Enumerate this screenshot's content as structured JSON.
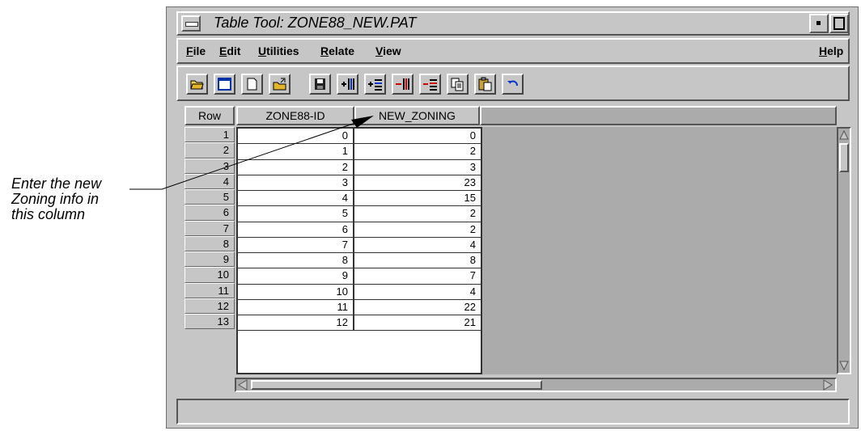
{
  "annotation": {
    "lines": [
      "Enter the new",
      "Zoning info in",
      "this column"
    ]
  },
  "window": {
    "title": "Table Tool: ZONE88_NEW.PAT"
  },
  "menu": {
    "file": "File",
    "edit": "Edit",
    "utilities": "Utilities",
    "relate": "Relate",
    "view": "View",
    "help": "Help"
  },
  "toolbar": {
    "icons": [
      "open-folder-icon",
      "new-window-icon",
      "new-document-icon",
      "open-file-icon",
      "save-icon",
      "add-column-icon",
      "add-row-icon",
      "delete-column-icon",
      "delete-row-icon",
      "copy-icon",
      "paste-icon",
      "undo-icon"
    ]
  },
  "table": {
    "headers": [
      "Row",
      "ZONE88-ID",
      "NEW_ZONING"
    ],
    "rows": [
      {
        "row": "1",
        "zone88_id": "0",
        "new_zoning": "0"
      },
      {
        "row": "2",
        "zone88_id": "1",
        "new_zoning": "2"
      },
      {
        "row": "3",
        "zone88_id": "2",
        "new_zoning": "3"
      },
      {
        "row": "4",
        "zone88_id": "3",
        "new_zoning": "23"
      },
      {
        "row": "5",
        "zone88_id": "4",
        "new_zoning": "15"
      },
      {
        "row": "6",
        "zone88_id": "5",
        "new_zoning": "2"
      },
      {
        "row": "7",
        "zone88_id": "6",
        "new_zoning": "2"
      },
      {
        "row": "8",
        "zone88_id": "7",
        "new_zoning": "4"
      },
      {
        "row": "9",
        "zone88_id": "8",
        "new_zoning": "8"
      },
      {
        "row": "10",
        "zone88_id": "9",
        "new_zoning": "7"
      },
      {
        "row": "11",
        "zone88_id": "10",
        "new_zoning": "4"
      },
      {
        "row": "12",
        "zone88_id": "11",
        "new_zoning": "22"
      },
      {
        "row": "13",
        "zone88_id": "12",
        "new_zoning": "21"
      }
    ]
  }
}
